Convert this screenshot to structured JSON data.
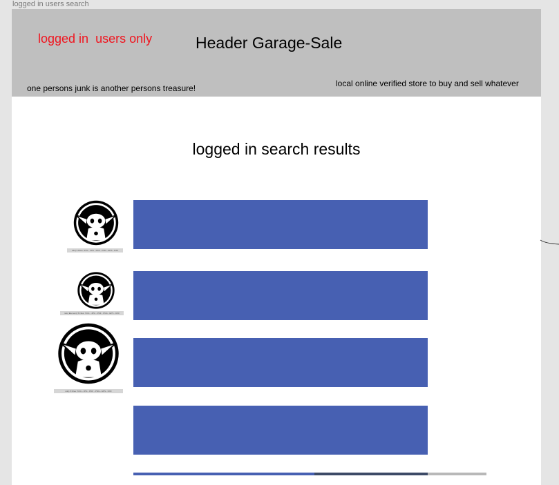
{
  "frame_label": "logged in users search",
  "header": {
    "login_note": "logged in  users only",
    "title": "Header Garage-Sale",
    "tagline_left": "one persons junk is another persons treasure!",
    "tagline_right": "local online verified store to buy and sell whatever"
  },
  "main": {
    "results_title": "logged in search results",
    "results": [
      {
        "caption": "ndo) 5 Files: SVG - JPG - PDF - PNG - EPS - DXF"
      },
      {
        "caption": "ndo) Element) 5 Files: SVG - JPG - PDF - PNG - EPS - DXF"
      },
      {
        "caption": "ndo) 5 Files: SVG - JPG - PDF - PNG - EPS - DXF"
      },
      {
        "caption": ""
      }
    ]
  },
  "colors": {
    "header_bg": "#bfbfbf",
    "result_bar": "#4760b2",
    "login_note": "#f0141e"
  }
}
